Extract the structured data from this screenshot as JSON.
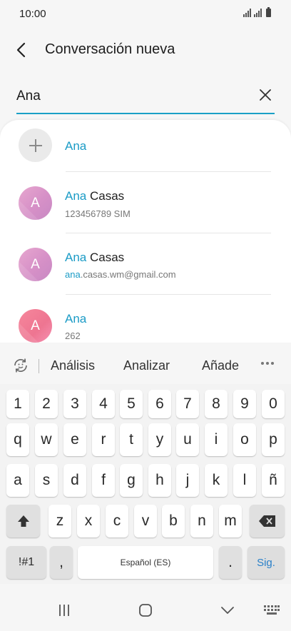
{
  "status": {
    "time": "10:00"
  },
  "header": {
    "title": "Conversación nueva"
  },
  "search": {
    "value": "Ana"
  },
  "results": [
    {
      "type": "add",
      "name_highlight": "Ana",
      "name_rest": ""
    },
    {
      "type": "contact",
      "avatar_letter": "A",
      "name_highlight": "Ana",
      "name_rest": " Casas",
      "sub_highlight": "",
      "sub_rest": "123456789  SIM"
    },
    {
      "type": "contact",
      "avatar_letter": "A",
      "name_highlight": "Ana",
      "name_rest": " Casas",
      "sub_highlight": "ana",
      "sub_rest": ".casas.wm@gmail.com"
    },
    {
      "type": "contact",
      "avatar_letter": "A",
      "name_highlight": "Ana",
      "name_rest": "",
      "sub_highlight": "",
      "sub_rest": "262"
    }
  ],
  "suggestions": [
    "Análisis",
    "Analizar",
    "Añade"
  ],
  "keyboard": {
    "numbers": [
      "1",
      "2",
      "3",
      "4",
      "5",
      "6",
      "7",
      "8",
      "9",
      "0"
    ],
    "row1": [
      "q",
      "w",
      "e",
      "r",
      "t",
      "y",
      "u",
      "i",
      "o",
      "p"
    ],
    "row2": [
      "a",
      "s",
      "d",
      "f",
      "g",
      "h",
      "j",
      "k",
      "l",
      "ñ"
    ],
    "row3": [
      "z",
      "x",
      "c",
      "v",
      "b",
      "n",
      "m"
    ],
    "symbols_label": "!#1",
    "comma_label": ",",
    "space_label": "Español (ES)",
    "period_label": ".",
    "enter_label": "Sig."
  },
  "colors": {
    "accent": "#1a9bc6",
    "enter_text": "#2980c9",
    "avatar_pink": "#d690c7",
    "avatar_red": "#ee7591"
  },
  "icons": {
    "back": "back-arrow-icon",
    "clear": "close-icon",
    "add": "plus-icon",
    "emoji": "emoji-refresh-icon",
    "more": "more-horizontal-icon",
    "shift": "shift-arrow-icon",
    "backspace": "backspace-icon",
    "nav_recents": "recents-icon",
    "nav_home": "home-icon",
    "nav_back": "chevron-down-icon",
    "nav_keyboard": "keyboard-icon"
  }
}
